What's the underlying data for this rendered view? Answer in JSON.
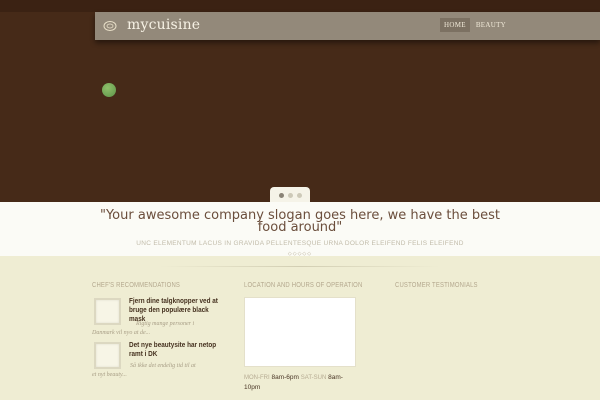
{
  "header": {
    "logo_text": "mycuisine",
    "nav": [
      {
        "label": "HOME",
        "active": true
      },
      {
        "label": "BEAUTY",
        "active": false
      }
    ]
  },
  "slider": {
    "pager_count": 3,
    "active_index": 0
  },
  "slogan": {
    "title": "\"Your awesome company slogan goes here, we have the best food around\"",
    "subtitle": "unc elementum lacus in gravida pellentesque urna dolor eleifend felis eleifend",
    "ornament": "◇◇◇◇◇"
  },
  "columns": {
    "recommendations": {
      "heading": "CHEF'S RECOMMENDATIONS",
      "items": [
        {
          "title": "Fjern dine talgknopper ved at bruge den populære black mask",
          "excerpt_line1": "Rigtig mange personer i",
          "excerpt_line2": "Danmark vil nyo at de..."
        },
        {
          "title": "Det nye beautysite har netop ramt i DK",
          "excerpt_line1": "Så ikke det endelig tid til at",
          "excerpt_line2": "et nyt beauty..."
        }
      ]
    },
    "location": {
      "heading": "LOCATION AND HOURS OF OPERATION",
      "weekday_label": "MON-FRI",
      "weekday_hours": "8am-6pm",
      "weekend_label": "SAT-SUN",
      "weekend_hours": "8am-10pm"
    },
    "testimonials": {
      "heading": "CUSTOMER TESTIMONIALS"
    }
  },
  "colors": {
    "hero_bg": "#462a18",
    "header_bar": "#93897a",
    "page_bg": "#efedd3",
    "slogan_text": "#6b4e3c"
  }
}
